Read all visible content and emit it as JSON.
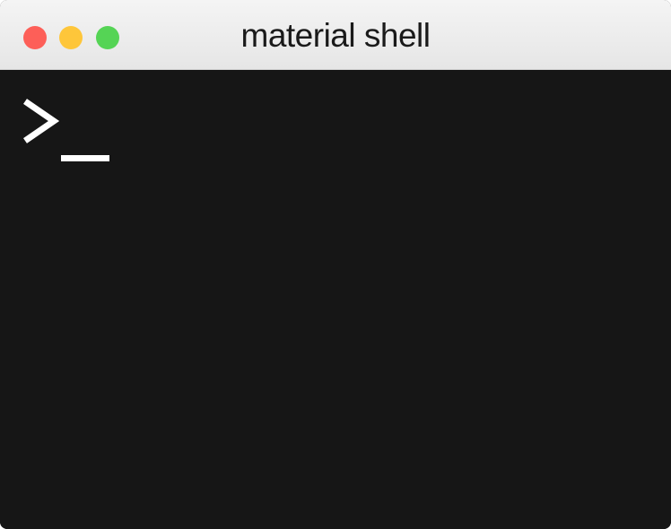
{
  "window": {
    "title": "material shell"
  },
  "titlebar": {
    "buttons": [
      {
        "name": "close",
        "color": "#fd5f58"
      },
      {
        "name": "minimize",
        "color": "#fec63a"
      },
      {
        "name": "maximize",
        "color": "#55d455"
      }
    ]
  },
  "terminal": {
    "background": "#161616",
    "prompt_icon": "chevron-right-icon",
    "cursor_icon": "underscore-cursor"
  }
}
